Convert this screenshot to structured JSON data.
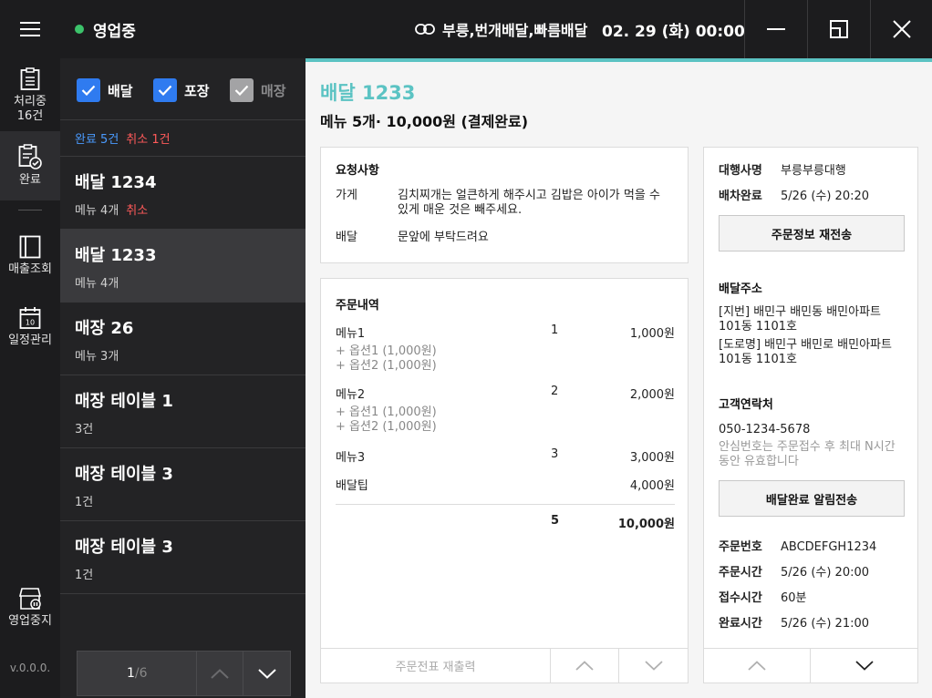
{
  "header": {
    "status": "영업중",
    "agency": "부릉,번개배달,빠름배달",
    "datetime": "02. 29 (화) 00:00",
    "accent_color": "#5bc3c3",
    "status_color": "#3cc36b"
  },
  "nav": {
    "items": [
      {
        "label": "처리중\n16건",
        "icon": "list-icon"
      },
      {
        "label": "완료",
        "icon": "completed-list-icon"
      },
      {
        "label": "매출조회",
        "icon": "sales-icon"
      },
      {
        "label": "일정관리",
        "icon": "calendar-icon"
      }
    ],
    "processing_label_1": "처리중",
    "processing_label_2": "16건",
    "done_label": "완료",
    "sales_label": "매출조회",
    "schedule_label": "일정관리",
    "calendar_day": "10",
    "store_pause_label": "영업중지",
    "version": "v.0.0.0."
  },
  "filters": {
    "delivery": "배달",
    "takeout": "포장",
    "store": "매장"
  },
  "counts": {
    "done": "완료 5건",
    "cancel": "취소 1건"
  },
  "orders": [
    {
      "title": "배달 1234",
      "sub": "메뉴 4개",
      "badge": "취소"
    },
    {
      "title": "배달 1233",
      "sub": "메뉴 4개",
      "badge": ""
    },
    {
      "title": "매장 26",
      "sub": "메뉴 3개",
      "badge": ""
    },
    {
      "title": "매장 테이블 1",
      "sub": "3건",
      "badge": ""
    },
    {
      "title": "매장 테이블 3",
      "sub": "1건",
      "badge": ""
    },
    {
      "title": "매장 테이블 3",
      "sub": "1건",
      "badge": ""
    }
  ],
  "pager": {
    "current": "1",
    "total": "/6"
  },
  "detail": {
    "title": "배달 1233",
    "summary": "메뉴 5개· 10,000원 (결제완료)",
    "request": {
      "title": "요청사항",
      "store_key": "가게",
      "store_value": "김치찌개는 얼큰하게 해주시고 김밥은 아이가 먹을 수 있게 매운 것은 빼주세요.",
      "delivery_key": "배달",
      "delivery_value": "문앞에 부탁드려요"
    },
    "items": {
      "title": "주문내역",
      "rows": [
        {
          "name": "메뉴1",
          "qty": "1",
          "price": "1,000원",
          "options": [
            "+ 옵션1 (1,000원)",
            "+ 옵션2 (1,000원)"
          ]
        },
        {
          "name": "메뉴2",
          "qty": "2",
          "price": "2,000원",
          "options": [
            "+ 옵션1 (1,000원)",
            "+ 옵션2 (1,000원)"
          ]
        },
        {
          "name": "메뉴3",
          "qty": "3",
          "price": "3,000원",
          "options": []
        }
      ],
      "tip_label": "배달팁",
      "tip_price": "4,000원",
      "total_qty": "5",
      "total_price": "10,000원",
      "reprint": "주문전표 재출력"
    },
    "info": {
      "agency_key": "대행사명",
      "agency_value": "부릉부릉대행",
      "dispatch_key": "배차완료",
      "dispatch_value": "5/26 (수) 20:20",
      "resend_button": "주문정보 재전송",
      "address_title": "배달주소",
      "address_jibun": "[지번] 배민구 배민동 배민아파트 101동 1101호",
      "address_road": "[도로명] 배민구 배민로 배민아파트 101동 1101호",
      "contact_title": "고객연락처",
      "phone": "050-1234-5678",
      "phone_note": "안심번호는 주문접수 후 최대 N시간 동안 유효합니다",
      "notify_button": "배달완료 알림전송",
      "order_no_key": "주문번호",
      "order_no_value": "ABCDEFGH1234",
      "order_time_key": "주문시간",
      "order_time_value": "5/26 (수) 20:00",
      "accept_key": "접수시간",
      "accept_value": "60분",
      "complete_key": "완료시간",
      "complete_value": "5/26 (수) 21:00"
    }
  }
}
